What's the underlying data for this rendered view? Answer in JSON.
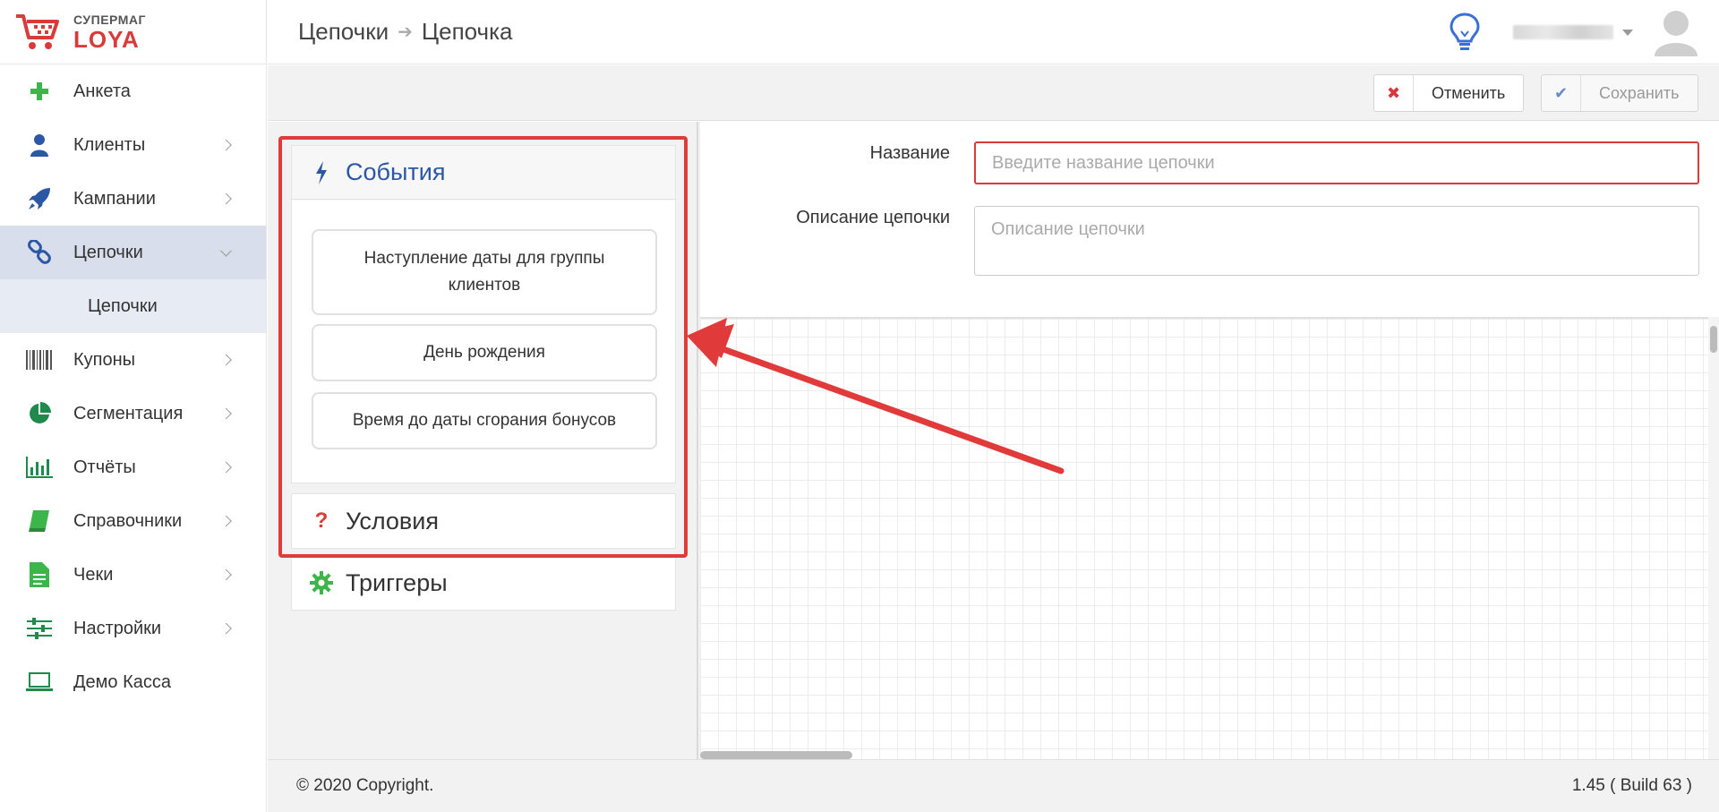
{
  "brand": {
    "top": "СУПЕРМАГ",
    "bottom": "LOYA"
  },
  "breadcrumb": {
    "parent": "Цепочки",
    "current": "Цепочка"
  },
  "sidebar": {
    "items": [
      {
        "label": "Анкета",
        "icon": "plus-icon"
      },
      {
        "label": "Клиенты",
        "icon": "user-icon"
      },
      {
        "label": "Кампании",
        "icon": "rocket-icon"
      },
      {
        "label": "Цепочки",
        "icon": "chain-icon"
      },
      {
        "label": "Купоны",
        "icon": "barcode-icon"
      },
      {
        "label": "Сегментация",
        "icon": "pie-chart-icon"
      },
      {
        "label": "Отчёты",
        "icon": "bar-chart-icon"
      },
      {
        "label": "Справочники",
        "icon": "book-icon"
      },
      {
        "label": "Чеки",
        "icon": "document-icon"
      },
      {
        "label": "Настройки",
        "icon": "sliders-icon"
      },
      {
        "label": "Демо Касса",
        "icon": "laptop-icon"
      }
    ],
    "sub_item": "Цепочки"
  },
  "toolbar": {
    "cancel_label": "Отменить",
    "save_label": "Сохранить"
  },
  "panels": {
    "events": {
      "title": "События",
      "items": [
        "Наступление даты для группы клиентов",
        "День рождения",
        "Время до даты сгорания бонусов"
      ]
    },
    "conditions": {
      "title": "Условия"
    },
    "triggers": {
      "title": "Триггеры"
    }
  },
  "form": {
    "name_label": "Название",
    "name_placeholder": "Введите название цепочки",
    "desc_label": "Описание цепочки",
    "desc_placeholder": "Описание цепочки"
  },
  "footer": {
    "copyright": "© 2020 Copyright.",
    "version": "1.45 ( Build 63 )"
  },
  "colors": {
    "accent_red": "#e03a3a",
    "brand_blue": "#2b57a5",
    "green": "#3cb54a"
  }
}
